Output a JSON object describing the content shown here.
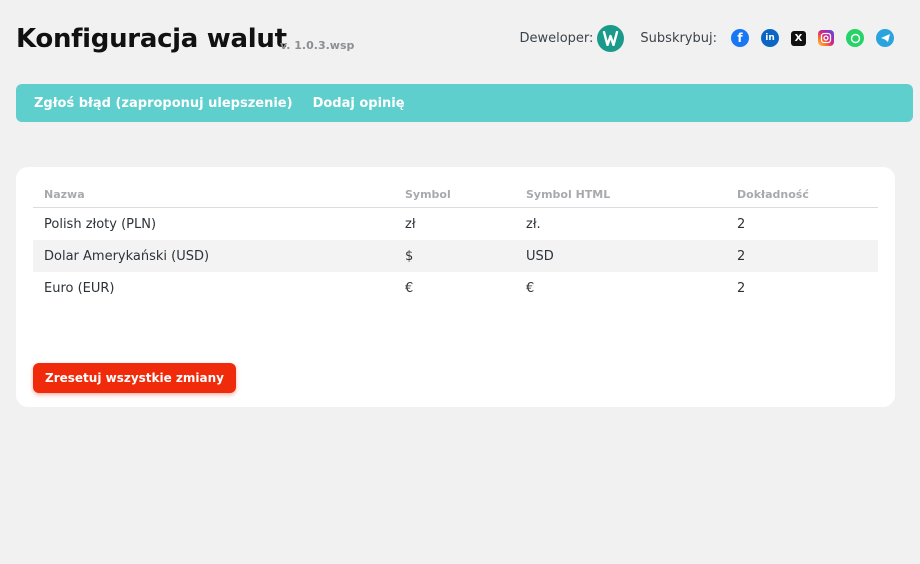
{
  "header": {
    "title": "Konfiguracja walut",
    "version": "v. 1.0.3.wsp",
    "developer_label": "Deweloper:",
    "subscribe_label": "Subskrybuj:",
    "social_icons": [
      "facebook-icon",
      "linkedin-icon",
      "x-icon",
      "instagram-icon",
      "whatsapp-icon",
      "telegram-icon"
    ]
  },
  "nav": {
    "report_bug": "Zgłoś błąd (zaproponuj ulepszenie)",
    "add_review": "Dodaj opinię"
  },
  "table": {
    "columns": [
      "Nazwa",
      "Symbol",
      "Symbol HTML",
      "Dokładność"
    ],
    "rows": [
      [
        "Polish złoty (PLN)",
        "zł",
        "zł.",
        "2"
      ],
      [
        "Dolar Amerykański (USD)",
        "$",
        "USD",
        "2"
      ],
      [
        "Euro (EUR)",
        "€",
        "€",
        "2"
      ]
    ]
  },
  "actions": {
    "reset_label": "Zresetuj wszystkie zmiany"
  },
  "colors": {
    "nav_bg": "#5ecfcd",
    "reset_bg": "#ef2b0b",
    "developer_logo": "#1a9a8a"
  }
}
